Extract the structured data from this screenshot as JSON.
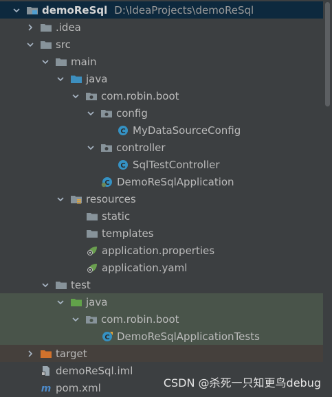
{
  "project": {
    "name": "demoReSql",
    "path": "D:\\IdeaProjects\\demoReSql"
  },
  "tree": [
    {
      "label": "demoReSql",
      "depth": 0,
      "expanded": true,
      "icon": "module-folder-icon"
    },
    {
      "label": ".idea",
      "depth": 1,
      "expanded": false,
      "icon": "folder-icon"
    },
    {
      "label": "src",
      "depth": 1,
      "expanded": true,
      "icon": "folder-icon"
    },
    {
      "label": "main",
      "depth": 2,
      "expanded": true,
      "icon": "folder-icon"
    },
    {
      "label": "java",
      "depth": 3,
      "expanded": true,
      "icon": "source-folder-icon"
    },
    {
      "label": "com.robin.boot",
      "depth": 4,
      "expanded": true,
      "icon": "package-icon"
    },
    {
      "label": "config",
      "depth": 5,
      "expanded": true,
      "icon": "package-icon"
    },
    {
      "label": "MyDataSourceConfig",
      "depth": 6,
      "icon": "class-icon"
    },
    {
      "label": "controller",
      "depth": 5,
      "expanded": true,
      "icon": "package-icon"
    },
    {
      "label": "SqlTestController",
      "depth": 6,
      "icon": "class-icon"
    },
    {
      "label": "DemoReSqlApplication",
      "depth": 5,
      "icon": "spring-boot-class-icon"
    },
    {
      "label": "resources",
      "depth": 3,
      "expanded": true,
      "icon": "resources-folder-icon"
    },
    {
      "label": "static",
      "depth": 4,
      "icon": "folder-icon"
    },
    {
      "label": "templates",
      "depth": 4,
      "icon": "folder-icon"
    },
    {
      "label": "application.properties",
      "depth": 4,
      "icon": "spring-config-icon"
    },
    {
      "label": "application.yaml",
      "depth": 4,
      "icon": "spring-config-icon"
    },
    {
      "label": "test",
      "depth": 2,
      "expanded": true,
      "icon": "folder-icon"
    },
    {
      "label": "java",
      "depth": 3,
      "expanded": true,
      "icon": "test-source-folder-icon"
    },
    {
      "label": "com.robin.boot",
      "depth": 4,
      "expanded": true,
      "icon": "package-icon"
    },
    {
      "label": "DemoReSqlApplicationTests",
      "depth": 5,
      "icon": "test-class-icon"
    },
    {
      "label": "target",
      "depth": 1,
      "expanded": false,
      "icon": "excluded-folder-icon"
    },
    {
      "label": "demoReSql.iml",
      "depth": 1,
      "icon": "iml-file-icon"
    },
    {
      "label": "pom.xml",
      "depth": 1,
      "icon": "maven-file-icon"
    }
  ],
  "watermark": "CSDN @杀死一只知更鸟debug",
  "colors": {
    "background": "#3c3f41",
    "selection": "#0d293e",
    "test_highlight": "#49544a",
    "excluded_highlight": "#45403c",
    "text": "#bbbbbb"
  }
}
